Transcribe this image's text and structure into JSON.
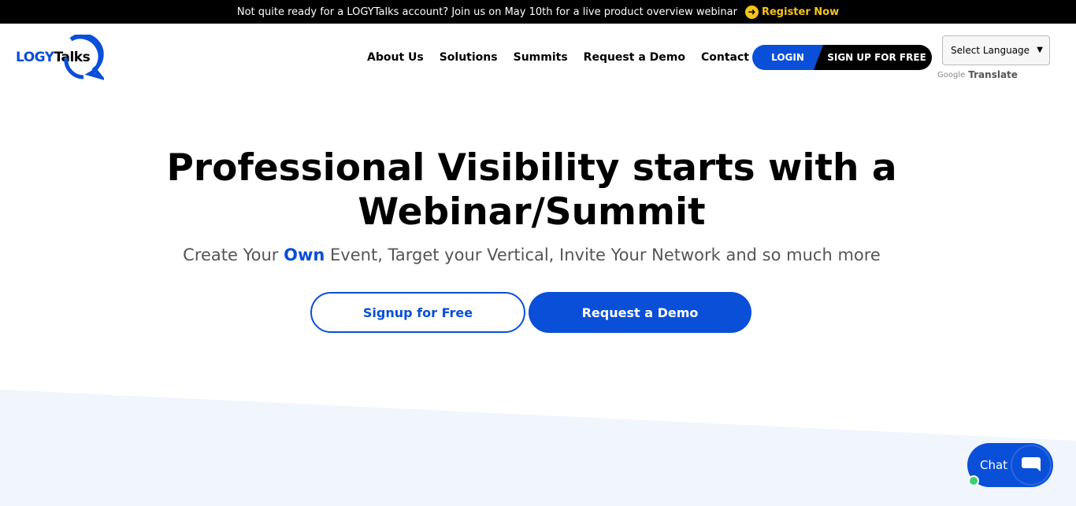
{
  "topbar": {
    "message": "Not quite ready for a LOGYTalks account? Join us on May 10th for a live product overview webinar",
    "register_label": "Register Now",
    "register_icon": "arrow-right-circle-icon"
  },
  "header": {
    "logo_part1": "LOGY",
    "logo_part2": "Talks",
    "nav": [
      {
        "label": "About Us"
      },
      {
        "label": "Solutions"
      },
      {
        "label": "Summits"
      },
      {
        "label": "Request a Demo"
      },
      {
        "label": "Contact Us"
      }
    ],
    "login_label": "LOGIN",
    "signup_label": "SIGN UP FOR FREE",
    "language_select": "Select Language",
    "google_label": "Google",
    "translate_label": "Translate"
  },
  "hero": {
    "title_line1": "Professional Visibility starts with a",
    "title_line2": "Webinar/Summit",
    "sub_before": "Create Your",
    "sub_highlight": "Own",
    "sub_after": "Event, Target your Vertical, Invite Your Network and so much more",
    "cta_outline": "Signup for Free",
    "cta_solid": "Request a Demo"
  },
  "chat": {
    "label": "Chat"
  },
  "colors": {
    "brand_blue": "#0a4fd8",
    "topbar_bg": "#000000",
    "accent_yellow": "#f5c518",
    "band_bg": "#f1f6fd"
  }
}
